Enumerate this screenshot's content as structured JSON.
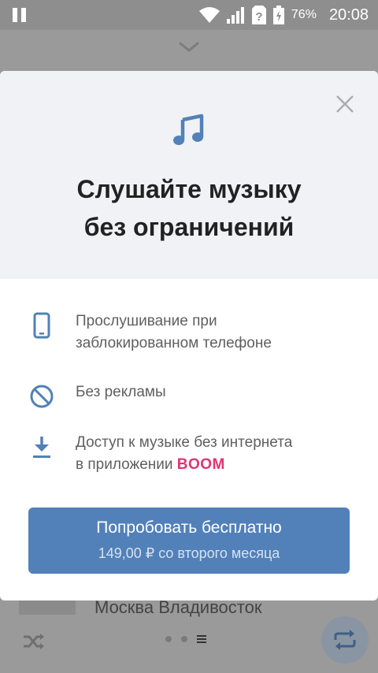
{
  "status_bar": {
    "battery_percent": "76%",
    "time": "20:08"
  },
  "background": {
    "track_title": "Москва Владивосток"
  },
  "modal": {
    "title_line1": "Слушайте музыку",
    "title_line2": "без ограничений",
    "features": [
      {
        "icon": "phone-icon",
        "line1": "Прослушивание при",
        "line2": "заблокированном телефоне"
      },
      {
        "icon": "no-ads-icon",
        "line1": "Без рекламы",
        "line2": ""
      },
      {
        "icon": "download-icon",
        "line1": "Доступ к музыке без интернета",
        "line2_prefix": "в приложении ",
        "brand": "BOOM"
      }
    ],
    "cta": {
      "label": "Попробовать бесплатно",
      "sublabel": "149,00 ₽ со второго месяца"
    }
  },
  "colors": {
    "accent": "#5281b9",
    "brand_boom": "#e6326e",
    "icon_blue": "#5181b8"
  }
}
